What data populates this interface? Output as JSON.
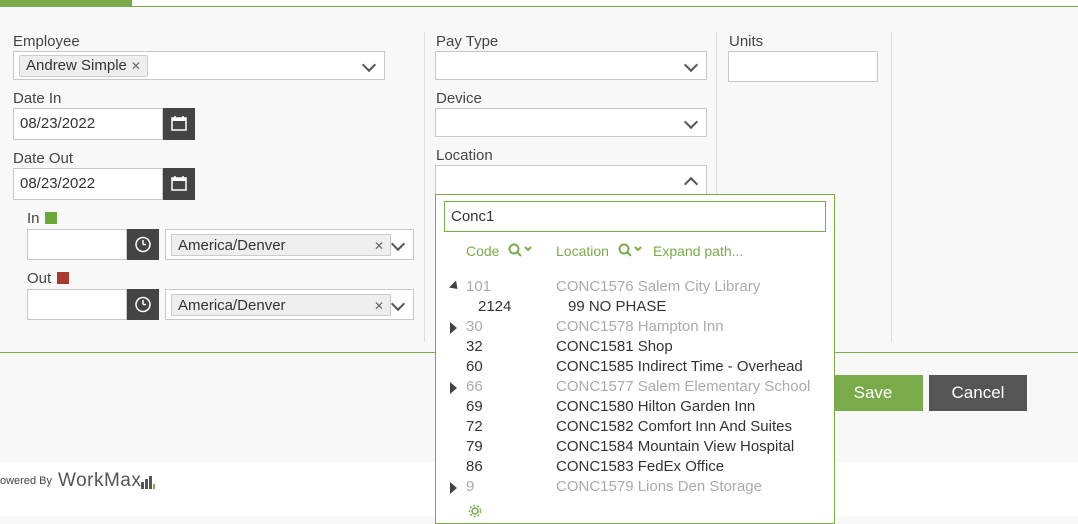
{
  "form": {
    "employee_label": "Employee",
    "employee_tag": "Andrew Simple",
    "date_in_label": "Date In",
    "date_in_value": "08/23/2022",
    "date_out_label": "Date Out",
    "date_out_value": "08/23/2022",
    "in_label": "In",
    "out_label": "Out",
    "in_timezone": "America/Denver",
    "out_timezone": "America/Denver",
    "pay_type_label": "Pay Type",
    "device_label": "Device",
    "location_label": "Location",
    "units_label": "Units",
    "in_indicator_color": "#6aaa3a",
    "out_indicator_color": "#a83a32"
  },
  "location_dropdown": {
    "search_value": "Conc1",
    "code_header": "Code",
    "location_header": "Location",
    "expand_path_label": "Expand path...",
    "rows": [
      {
        "code": "101",
        "location": "CONC1576 Salem City Library",
        "style": "grey",
        "toggle": "expanded"
      },
      {
        "code": "2124",
        "location": "99 NO PHASE",
        "style": "child",
        "toggle": "none"
      },
      {
        "code": "30",
        "location": "CONC1578 Hampton Inn",
        "style": "grey",
        "toggle": "collapsed"
      },
      {
        "code": "32",
        "location": "CONC1581 Shop",
        "style": "dark",
        "toggle": "none"
      },
      {
        "code": "60",
        "location": "CONC1585 Indirect Time - Overhead",
        "style": "dark",
        "toggle": "none"
      },
      {
        "code": "66",
        "location": "CONC1577 Salem Elementary School",
        "style": "grey",
        "toggle": "collapsed"
      },
      {
        "code": "69",
        "location": "CONC1580 Hilton Garden Inn",
        "style": "dark",
        "toggle": "none"
      },
      {
        "code": "72",
        "location": "CONC1582 Comfort Inn And Suites",
        "style": "dark",
        "toggle": "none"
      },
      {
        "code": "79",
        "location": "CONC1584 Mountain View Hospital",
        "style": "dark",
        "toggle": "none"
      },
      {
        "code": "86",
        "location": "CONC1583 FedEx Office",
        "style": "dark",
        "toggle": "none"
      },
      {
        "code": "9",
        "location": "CONC1579 Lions Den Storage",
        "style": "grey",
        "toggle": "collapsed"
      }
    ]
  },
  "actions": {
    "save_label": "Save",
    "cancel_label": "Cancel",
    "save_color": "#7aab4a",
    "cancel_color": "#555555"
  },
  "footer": {
    "powered_by": "owered By",
    "brand": "WorkMax"
  }
}
